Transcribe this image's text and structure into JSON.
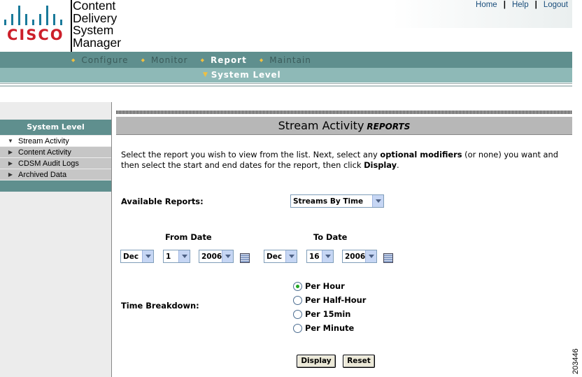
{
  "brand": {
    "wordmark": "CISCO",
    "app_name_lines": [
      "Content",
      "Delivery",
      "System",
      "Manager"
    ],
    "accent": "#5f8f8e",
    "wordmark_color": "#cc1f2a"
  },
  "top_links": {
    "home": "Home",
    "help": "Help",
    "logout": "Logout",
    "separator": "|"
  },
  "nav": {
    "items": [
      {
        "label": "Configure",
        "active": false
      },
      {
        "label": "Monitor",
        "active": false
      },
      {
        "label": "Report",
        "active": true
      },
      {
        "label": "Maintain",
        "active": false
      }
    ],
    "sub_item": "System Level"
  },
  "sidebar": {
    "heading": "System Level",
    "items": [
      {
        "label": "Stream Activity",
        "expanded": true,
        "active": true
      },
      {
        "label": "Content Activity",
        "expanded": false,
        "active": false
      },
      {
        "label": "CDSM Audit Logs",
        "expanded": false,
        "active": false
      },
      {
        "label": "Archived Data",
        "expanded": false,
        "active": false
      }
    ]
  },
  "page": {
    "title": "Stream Activity",
    "title_suffix": "REPORTS",
    "intro_1": "Select the report you wish to view from the list. Next, select any ",
    "intro_bold_1": "optional modifiers",
    "intro_2": " (or none) you want and then select the start and end dates for the report, then click ",
    "intro_bold_2": "Display",
    "intro_3": "."
  },
  "form": {
    "available_reports_label": "Available Reports:",
    "report_selected": "Streams By Time",
    "from_date_label": "From Date",
    "to_date_label": "To Date",
    "from": {
      "month": "Dec",
      "day": "1",
      "year": "2006"
    },
    "to": {
      "month": "Dec",
      "day": "16",
      "year": "2006"
    },
    "time_breakdown_label": "Time Breakdown:",
    "breakdown_options": [
      {
        "label": "Per Hour",
        "checked": true
      },
      {
        "label": "Per Half-Hour",
        "checked": false
      },
      {
        "label": "Per 15min",
        "checked": false
      },
      {
        "label": "Per Minute",
        "checked": false
      }
    ],
    "display_button": "Display",
    "reset_button": "Reset"
  },
  "figure_id": "203446"
}
